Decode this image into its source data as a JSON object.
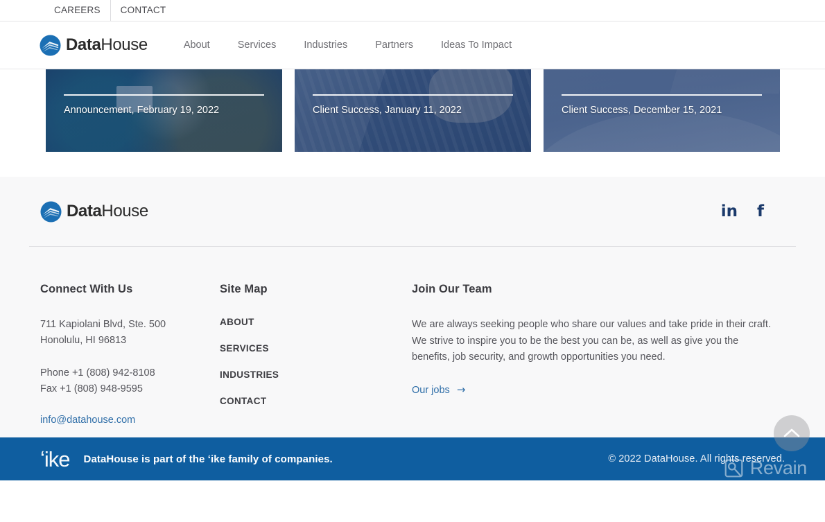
{
  "utility_bar": {
    "links": [
      {
        "label": "CAREERS",
        "name": "utility-link-careers"
      },
      {
        "label": "CONTACT",
        "name": "utility-link-contact"
      }
    ]
  },
  "header": {
    "brand": {
      "bold": "Data",
      "normal": "House",
      "alt": "DataHouse logo"
    },
    "nav": [
      {
        "label": "About"
      },
      {
        "label": "Services"
      },
      {
        "label": "Industries"
      },
      {
        "label": "Partners"
      },
      {
        "label": "Ideas To Impact"
      }
    ]
  },
  "cards": [
    {
      "meta": "Announcement, February 19, 2022"
    },
    {
      "meta": "Client Success, January 11, 2022"
    },
    {
      "meta": "Client Success, December 15, 2021"
    }
  ],
  "footer": {
    "brand": {
      "bold": "Data",
      "normal": "House"
    },
    "social": [
      {
        "glyph": "in",
        "name": "linkedin-icon"
      },
      {
        "glyph": "f",
        "name": "facebook-icon"
      }
    ],
    "connect": {
      "title": "Connect With Us",
      "address_line1": "711 Kapiolani Blvd, Ste. 500",
      "address_line2": "Honolulu, HI  96813",
      "phone": "Phone +1 (808) 942-8108",
      "fax": "Fax +1 (808) 948-9595",
      "email": "info@datahouse.com"
    },
    "sitemap": {
      "title": "Site Map",
      "links": [
        {
          "label": "ABOUT"
        },
        {
          "label": "SERVICES"
        },
        {
          "label": "INDUSTRIES"
        },
        {
          "label": "CONTACT"
        }
      ]
    },
    "team": {
      "title": "Join Our Team",
      "body": "We are always seeking people who share our values and take pride in their craft. We strive to inspire you to be the best you can be, as well as give you the benefits, job security, and growth opportunities you need.",
      "link_label": "Our jobs",
      "link_arrow": "→"
    }
  },
  "bottom_bar": {
    "ike_logo": "ʻike",
    "tagline": "DataHouse is part of the ʻike family of companies.",
    "copyright": "© 2022 DataHouse. All rights reserved."
  },
  "watermark": {
    "text": "Revain"
  },
  "colors": {
    "brand_blue": "#1b6fb4",
    "bottom_bar_blue": "#0f5ea0",
    "link_blue": "#2f6ea8",
    "social_navy": "#1b3a6b",
    "footer_bg": "#f8f8f9"
  }
}
